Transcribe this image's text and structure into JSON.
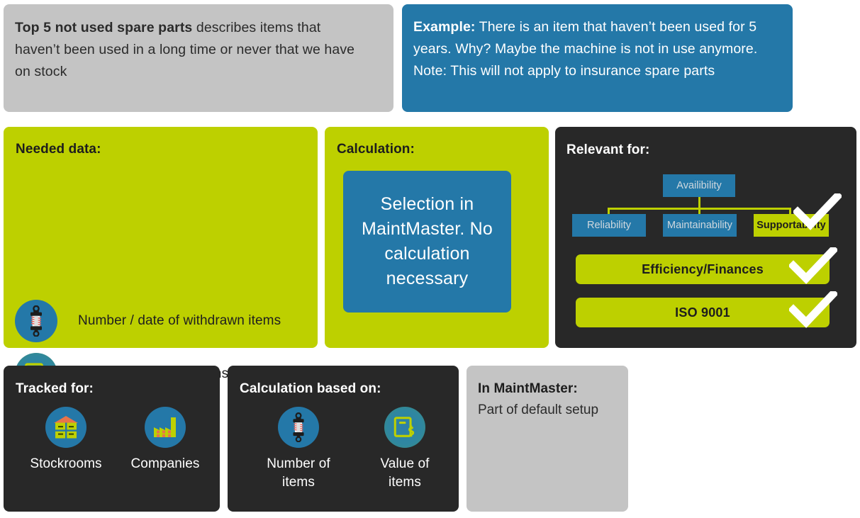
{
  "colors": {
    "green": "#bdd000",
    "blue": "#2478a8",
    "dark": "#282828",
    "gray": "#c4c4c4",
    "white": "#ffffff"
  },
  "description_card": {
    "bold_lead": "Top 5 not used spare parts",
    "rest": " describes items that haven’t been used in a long time or never that we have on stock"
  },
  "example_card": {
    "bold_lead": "Example:",
    "rest": " There is an item that haven’t been used for 5 years. Why? Maybe the machine is not in use anymore. Note: This will not apply to insurance spare parts"
  },
  "needed_data": {
    "heading": "Needed data:",
    "items": [
      {
        "icon": "shock-absorber-icon",
        "label": "Number / date of withdrawn items"
      },
      {
        "icon": "value-book-dollar-icon",
        "label": "Value of withdrawn items"
      }
    ]
  },
  "calculation": {
    "heading": "Calculation:",
    "box_text": "Selection in MaintMaster. No calculation necessary"
  },
  "relevant_for": {
    "heading": "Relevant for:",
    "tree": {
      "root": {
        "label": "Availibility",
        "state": "inactive"
      },
      "children": [
        {
          "label": "Reliability",
          "state": "inactive"
        },
        {
          "label": "Maintainability",
          "state": "inactive"
        },
        {
          "label": "Supportability",
          "state": "active",
          "checked": true
        }
      ]
    },
    "bars": [
      {
        "label": "Efficiency/Finances",
        "checked": true
      },
      {
        "label": "ISO 9001",
        "checked": true
      }
    ]
  },
  "tracked_for": {
    "heading": "Tracked for:",
    "items": [
      {
        "icon": "stockroom-icon",
        "label": "Stockrooms"
      },
      {
        "icon": "factory-icon",
        "label": "Companies"
      }
    ]
  },
  "calculation_based_on": {
    "heading": "Calculation based on:",
    "items": [
      {
        "icon": "shock-absorber-icon",
        "label": "Number of items"
      },
      {
        "icon": "value-book-dollar-icon",
        "label": "Value of items"
      }
    ]
  },
  "in_maintmaster": {
    "heading": "In MaintMaster:",
    "text": "Part of default setup"
  }
}
